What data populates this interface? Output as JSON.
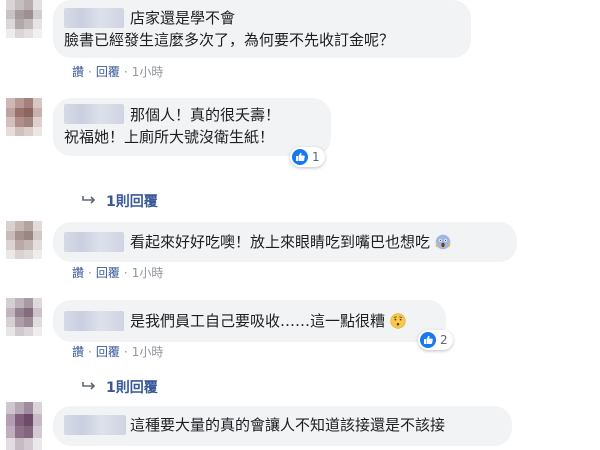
{
  "comments": [
    {
      "lines": [
        "店家還是學不會",
        "臉書已經發生這麼多次了，為何要不先收訂金呢？"
      ],
      "actions": {
        "like": "讚",
        "reply": "回覆",
        "time": "1小時"
      }
    },
    {
      "lines": [
        "那個人！真的很夭壽！",
        "祝福她！上廁所大號沒衛生紙！"
      ],
      "reaction": {
        "icon": "thumbs-up-icon",
        "count": "1"
      },
      "replies_link": "1則回覆"
    },
    {
      "lines": [
        "看起來好好吃噢！放上來眼睛吃到嘴巴也想吃"
      ],
      "emoji": "scream-face-icon",
      "actions": {
        "like": "讚",
        "reply": "回覆",
        "time": "1小時"
      }
    },
    {
      "lines": [
        "是我們員工自己要吸收……這一點很糟"
      ],
      "emoji": "worried-face-icon",
      "reaction": {
        "icon": "thumbs-up-icon",
        "count": "2"
      },
      "actions": {
        "like": "讚",
        "reply": "回覆",
        "time": "1小時"
      },
      "replies_link": "1則回覆"
    },
    {
      "lines": [
        "這種要大量的真的會讓人不知道該接還是不該接"
      ]
    }
  ],
  "separator": "·",
  "colors": {
    "link": "#385898",
    "meta": "#90949c",
    "bubble": "#f2f3f5",
    "like_blue": "#1877f2"
  }
}
